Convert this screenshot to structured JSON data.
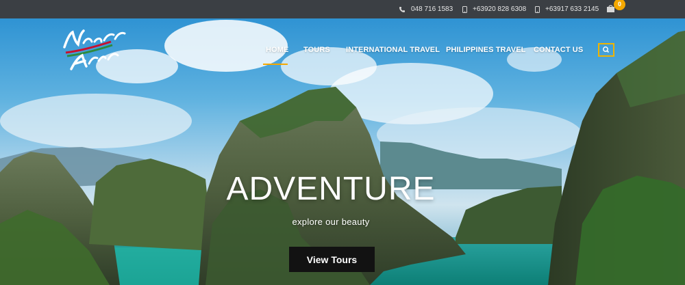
{
  "topbar": {
    "phones": [
      {
        "icon": "phone-icon",
        "number": "048 716 1583"
      },
      {
        "icon": "mobile-phone-icon",
        "number": "+63920 828 6308"
      },
      {
        "icon": "mobile-phone-icon",
        "number": "+63917 633 2145"
      }
    ],
    "cart": {
      "icon": "shopping-bag-icon",
      "count": "0"
    }
  },
  "logo": {
    "alt_text": "Natural Arts"
  },
  "nav": {
    "items": [
      {
        "label": "HOME",
        "active": true
      },
      {
        "label": "TOURS"
      },
      {
        "label": "INTERNATIONAL TRAVEL"
      },
      {
        "label": "PHILIPPINES TRAVEL"
      },
      {
        "label": "CONTACT US"
      }
    ],
    "search_icon": "search-icon"
  },
  "hero": {
    "headline": "ADVENTURE",
    "tagline": "explore our beauty",
    "cta": "View Tours"
  },
  "colors": {
    "topbar": "#3b3f44",
    "accent": "#f5a800",
    "button": "#121212",
    "water": "#1fa89a"
  }
}
